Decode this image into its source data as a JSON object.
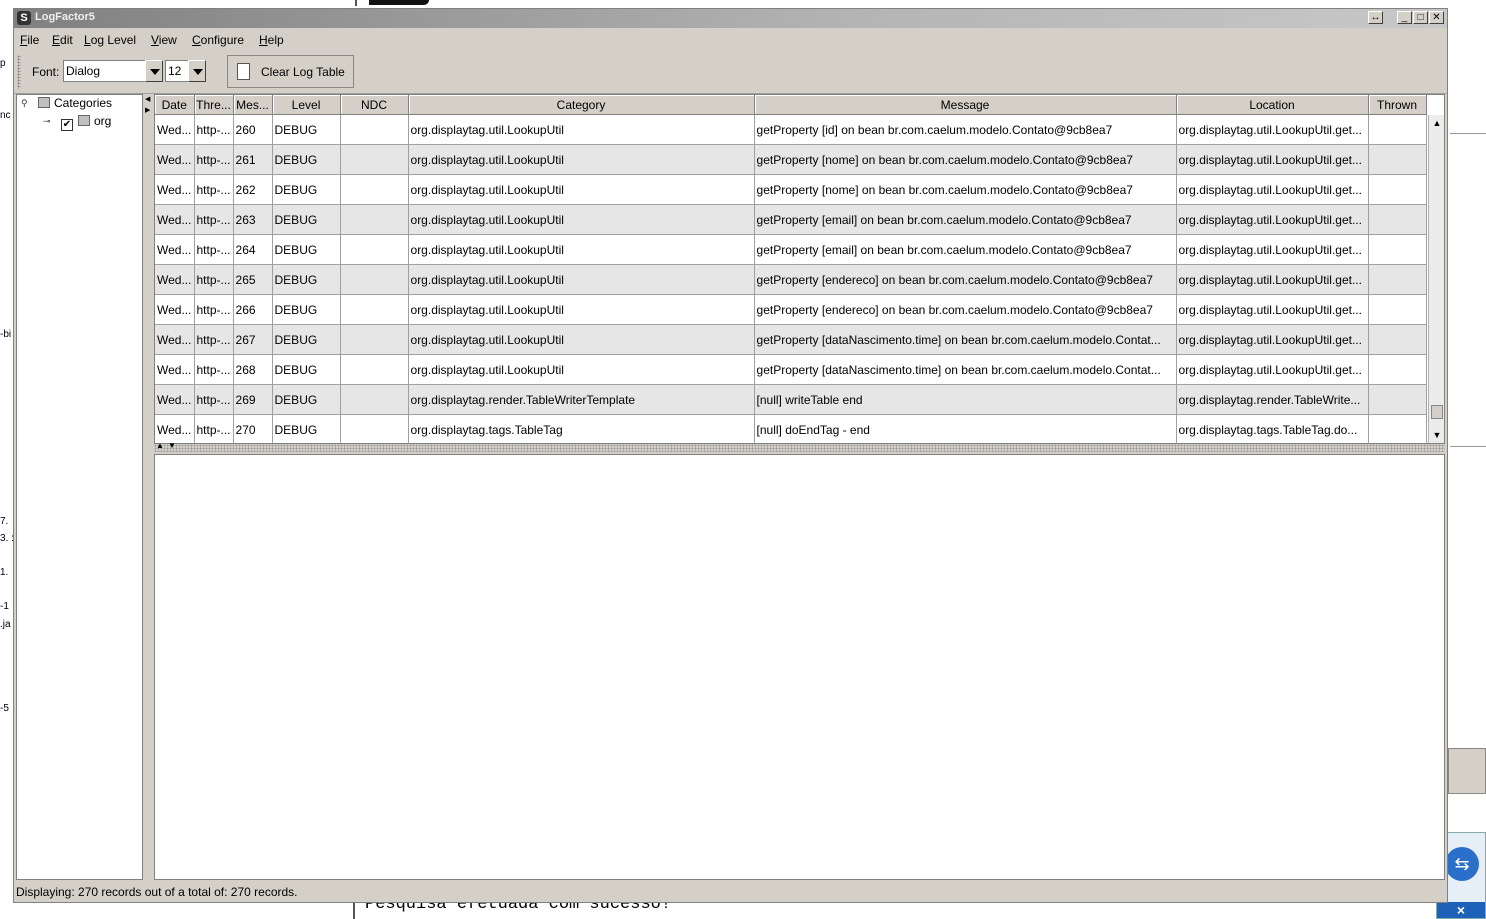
{
  "window": {
    "title": "LogFactor5",
    "controls": {
      "restore": "↔",
      "minimize": "_",
      "maximize": "□",
      "close": "✕"
    }
  },
  "menu": {
    "items": [
      {
        "u": "F",
        "rest": "ile"
      },
      {
        "u": "E",
        "rest": "dit"
      },
      {
        "u": "L",
        "rest": "og Level"
      },
      {
        "u": "V",
        "rest": "iew"
      },
      {
        "u": "C",
        "rest": "onfigure"
      },
      {
        "u": "H",
        "rest": "elp"
      }
    ]
  },
  "toolbar": {
    "font_label": "Font:",
    "font_value": "Dialog",
    "size_value": "12",
    "clear_label": "Clear Log Table"
  },
  "tree": {
    "root_label": "Categories",
    "child_label": "org",
    "child_checked": "✔"
  },
  "table": {
    "columns": [
      "Date",
      "Thre...",
      "Mes...",
      "Level",
      "NDC",
      "Category",
      "Message",
      "Location",
      "Thrown"
    ],
    "rows": [
      [
        "Wed...",
        "http-...",
        "260",
        "DEBUG",
        "",
        "org.displaytag.util.LookupUtil",
        "getProperty [id] on bean br.com.caelum.modelo.Contato@9cb8ea7",
        "org.displaytag.util.LookupUtil.get...",
        ""
      ],
      [
        "Wed...",
        "http-...",
        "261",
        "DEBUG",
        "",
        "org.displaytag.util.LookupUtil",
        "getProperty [nome] on bean br.com.caelum.modelo.Contato@9cb8ea7",
        "org.displaytag.util.LookupUtil.get...",
        ""
      ],
      [
        "Wed...",
        "http-...",
        "262",
        "DEBUG",
        "",
        "org.displaytag.util.LookupUtil",
        "getProperty [nome] on bean br.com.caelum.modelo.Contato@9cb8ea7",
        "org.displaytag.util.LookupUtil.get...",
        ""
      ],
      [
        "Wed...",
        "http-...",
        "263",
        "DEBUG",
        "",
        "org.displaytag.util.LookupUtil",
        "getProperty [email] on bean br.com.caelum.modelo.Contato@9cb8ea7",
        "org.displaytag.util.LookupUtil.get...",
        ""
      ],
      [
        "Wed...",
        "http-...",
        "264",
        "DEBUG",
        "",
        "org.displaytag.util.LookupUtil",
        "getProperty [email] on bean br.com.caelum.modelo.Contato@9cb8ea7",
        "org.displaytag.util.LookupUtil.get...",
        ""
      ],
      [
        "Wed...",
        "http-...",
        "265",
        "DEBUG",
        "",
        "org.displaytag.util.LookupUtil",
        "getProperty [endereco] on bean br.com.caelum.modelo.Contato@9cb8ea7",
        "org.displaytag.util.LookupUtil.get...",
        ""
      ],
      [
        "Wed...",
        "http-...",
        "266",
        "DEBUG",
        "",
        "org.displaytag.util.LookupUtil",
        "getProperty [endereco] on bean br.com.caelum.modelo.Contato@9cb8ea7",
        "org.displaytag.util.LookupUtil.get...",
        ""
      ],
      [
        "Wed...",
        "http-...",
        "267",
        "DEBUG",
        "",
        "org.displaytag.util.LookupUtil",
        "getProperty [dataNascimento.time] on bean br.com.caelum.modelo.Contat...",
        "org.displaytag.util.LookupUtil.get...",
        ""
      ],
      [
        "Wed...",
        "http-...",
        "268",
        "DEBUG",
        "",
        "org.displaytag.util.LookupUtil",
        "getProperty [dataNascimento.time] on bean br.com.caelum.modelo.Contat...",
        "org.displaytag.util.LookupUtil.get...",
        ""
      ],
      [
        "Wed...",
        "http-...",
        "269",
        "DEBUG",
        "",
        "org.displaytag.render.TableWriterTemplate",
        "[null] writeTable end",
        "org.displaytag.render.TableWrite...",
        ""
      ],
      [
        "Wed...",
        "http-...",
        "270",
        "DEBUG",
        "",
        "org.displaytag.tags.TableTag",
        "[null] doEndTag - end",
        "org.displaytag.tags.TableTag.do...",
        ""
      ]
    ]
  },
  "status": {
    "text": "Displaying: 270 records out of a total of: 270 records."
  },
  "background": {
    "bottom_text": "Pesquisa efetuada com sucesso!",
    "left_fragments": [
      "p",
      "nc",
      "-bi",
      "7.",
      "3. :",
      "1.",
      "-1",
      ".ja",
      "-5"
    ]
  }
}
